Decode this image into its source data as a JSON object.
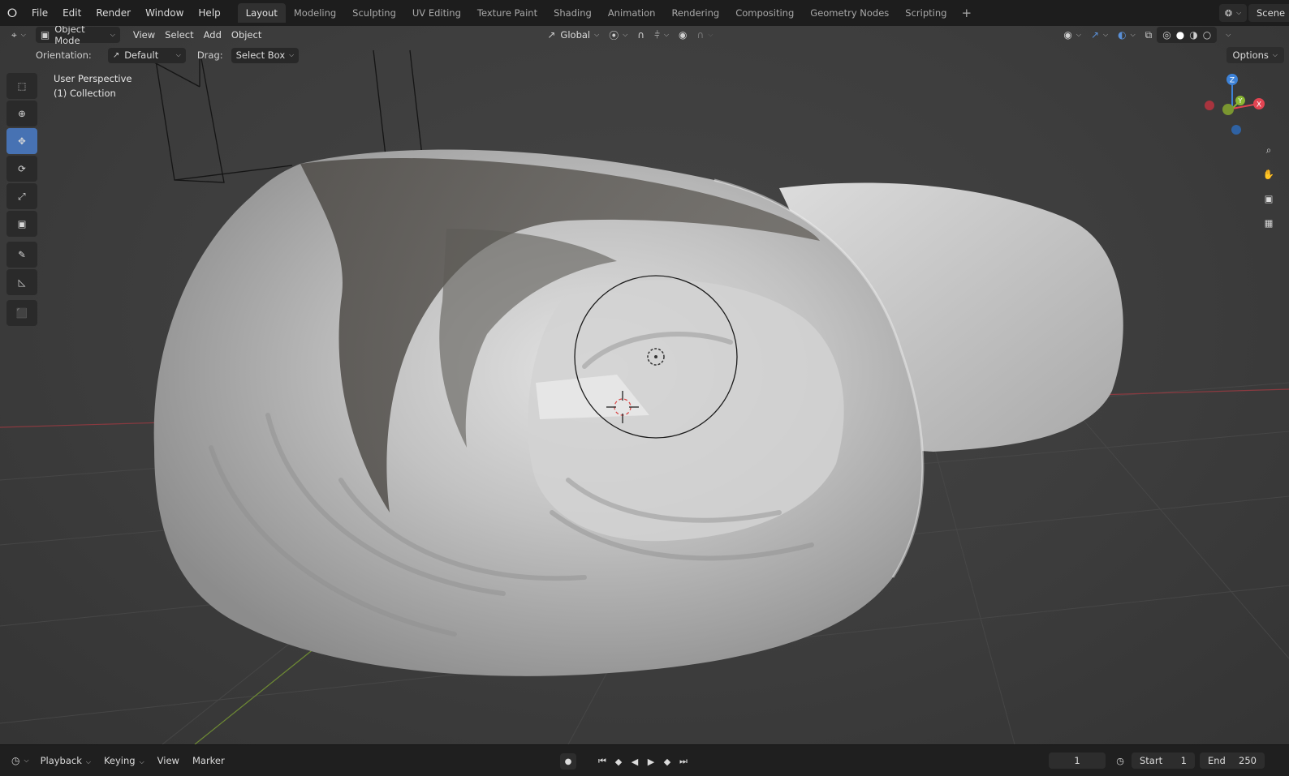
{
  "topbar": {
    "menu": [
      "File",
      "Edit",
      "Render",
      "Window",
      "Help"
    ],
    "workspaces": [
      "Layout",
      "Modeling",
      "Sculpting",
      "UV Editing",
      "Texture Paint",
      "Shading",
      "Animation",
      "Rendering",
      "Compositing",
      "Geometry Nodes",
      "Scripting"
    ],
    "active_workspace": "Layout",
    "scene_label": "Scene"
  },
  "header": {
    "mode": "Object Mode",
    "menus": [
      "View",
      "Select",
      "Add",
      "Object"
    ],
    "transform_orientation": "Global"
  },
  "tool_settings": {
    "orientation_label": "Orientation:",
    "orientation_value": "Default",
    "drag_label": "Drag:",
    "drag_value": "Select Box",
    "options_label": "Options"
  },
  "viewport": {
    "perspective": "User Perspective",
    "collection": "(1) Collection"
  },
  "gizmo": {
    "x": "X",
    "y": "Y",
    "z": "Z"
  },
  "timeline": {
    "menus": [
      "Playback",
      "Keying",
      "View",
      "Marker"
    ],
    "current_frame": "1",
    "start_label": "Start",
    "start_value": "1",
    "end_label": "End",
    "end_value": "250"
  },
  "icons": {
    "tools": [
      "select-box-icon",
      "cursor-icon",
      "move-icon",
      "rotate-icon",
      "scale-icon",
      "transform-icon",
      "annotate-icon",
      "measure-icon",
      "add-cube-icon"
    ],
    "nav": [
      "zoom-icon",
      "hand-icon",
      "camera-icon",
      "grid-view-icon"
    ]
  },
  "colors": {
    "active_tool": "#4772b3",
    "axis_x": "#e24452",
    "axis_y": "#8ab833",
    "axis_z": "#3d82d8"
  }
}
